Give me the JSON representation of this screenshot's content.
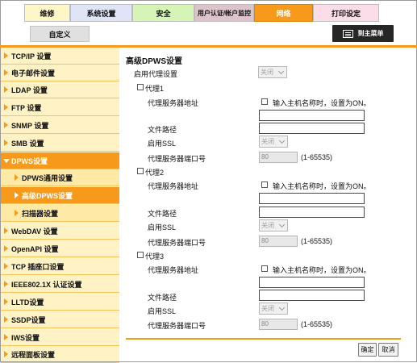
{
  "tabs": {
    "maintenance": "维修",
    "system": "系统设置",
    "security": "安全",
    "auth": "用户认证/帐户监控",
    "network": "网络",
    "print": "打印设定",
    "custom": "自定义"
  },
  "menu_button": "到主菜单",
  "sidebar": {
    "tcpip": "TCP/IP 设置",
    "email": "电子邮件设置",
    "ldap": "LDAP 设置",
    "ftp": "FTP 设置",
    "snmp": "SNMP 设置",
    "smb": "SMB 设置",
    "dpws": "DPWS设置",
    "dpws_general": "DPWS通用设置",
    "dpws_advanced": "高级DPWS设置",
    "scanner": "扫描器设置",
    "webdav": "WebDAV 设置",
    "openapi": "OpenAPI 设置",
    "tcpsocket": "TCP 插座口设置",
    "ieee": "IEEE802.1X 认证设置",
    "lltd": "LLTD设置",
    "ssdp": "SSDP设置",
    "iws": "IWS设置",
    "remote": "远程面板设置"
  },
  "main": {
    "title": "高级DPWS设置",
    "enable_proxy_label": "启用代理设置",
    "enable_proxy_value": "关闭",
    "proxy_server_label": "代理服务器地址",
    "hostname_label": "输入主机名称时，设置为ON。",
    "file_path_label": "文件路径",
    "ssl_label": "启用SSL",
    "ssl_value": "关闭",
    "port_label": "代理服务器端口号",
    "port_range": "(1-65535)",
    "proxy1": {
      "name": "代理1",
      "port": "80"
    },
    "proxy2": {
      "name": "代理2",
      "port": "80"
    },
    "proxy3": {
      "name": "代理3",
      "port": "80"
    }
  },
  "buttons": {
    "ok": "确定",
    "cancel": "取消"
  },
  "colors": {
    "accent": "#f79a1c",
    "sidebar_bg": "#fff3c6",
    "menu_button_bg": "#262626"
  }
}
